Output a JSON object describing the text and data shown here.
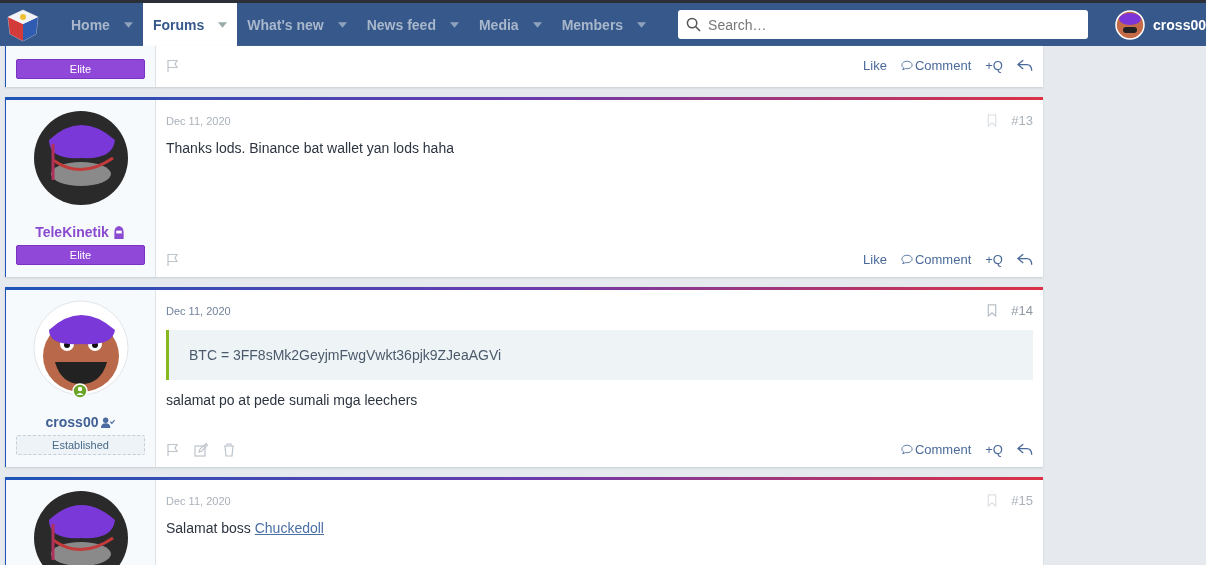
{
  "nav": {
    "items": [
      {
        "label": "Home",
        "selected": false
      },
      {
        "label": "Forums",
        "selected": true
      },
      {
        "label": "What's new",
        "selected": false
      },
      {
        "label": "News feed",
        "selected": false
      },
      {
        "label": "Media",
        "selected": false
      },
      {
        "label": "Members",
        "selected": false
      }
    ],
    "search": {
      "placeholder": "Search…"
    },
    "user": {
      "name": "cross00"
    }
  },
  "previous_post": {
    "user": {
      "kind": "elite",
      "badge": "Elite"
    },
    "actions": [
      "Like",
      "Comment",
      "+Q"
    ]
  },
  "posts": [
    {
      "date": "Dec 11, 2020",
      "number": "#13",
      "highlighted": false,
      "own": false,
      "user": {
        "kind": "elite",
        "name": "TeleKinetik",
        "badge": "Elite",
        "online": false
      },
      "body": [
        {
          "kind": "text",
          "text": "Thanks lods. Binance bat wallet yan lods haha"
        }
      ],
      "actions": [
        "Like",
        "Comment",
        "+Q"
      ]
    },
    {
      "date": "Dec 11, 2020",
      "number": "#14",
      "highlighted": true,
      "own": true,
      "user": {
        "kind": "established",
        "name": "cross00",
        "badge": "Established",
        "online": true
      },
      "quote": "BTC = 3FF8sMk2GeyjmFwgVwkt36pjk9ZJeaAGVi",
      "body": [
        {
          "kind": "text",
          "text": "salamat po at pede sumali mga leechers"
        }
      ],
      "actions": [
        "Comment",
        "+Q"
      ]
    },
    {
      "date": "Dec 11, 2020",
      "number": "#15",
      "highlighted": false,
      "user": {
        "kind": "elite",
        "online": false
      },
      "body": [
        {
          "kind": "text",
          "text": "Salamat boss "
        },
        {
          "kind": "link",
          "text": "Chuckedoll"
        }
      ]
    }
  ]
}
